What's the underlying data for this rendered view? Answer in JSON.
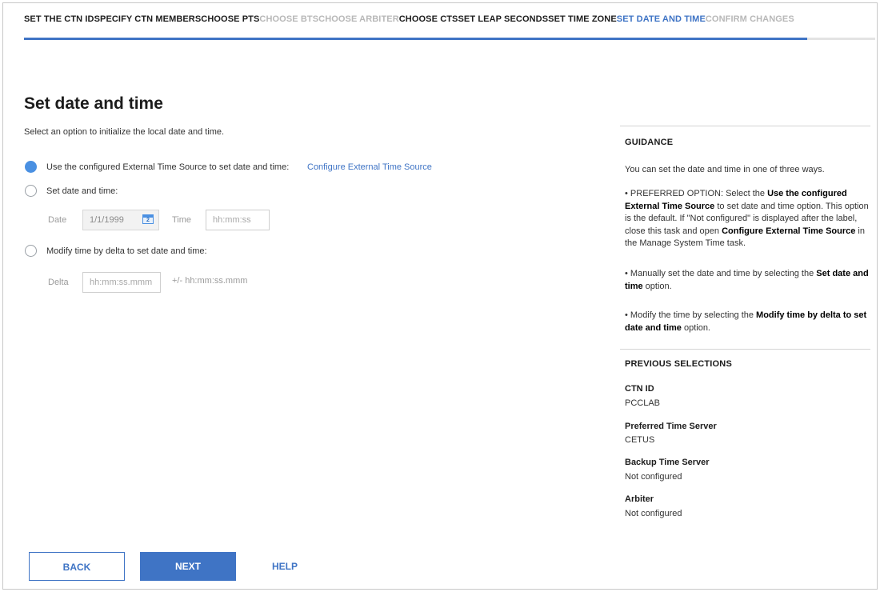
{
  "steps": [
    {
      "label": "SET THE CTN ID",
      "state": "done"
    },
    {
      "label": "SPECIFY CTN MEMBERS",
      "state": "done"
    },
    {
      "label": "CHOOSE PTS",
      "state": "done"
    },
    {
      "label": "CHOOSE BTS",
      "state": "disabled"
    },
    {
      "label": "CHOOSE ARBITER",
      "state": "disabled"
    },
    {
      "label": "CHOOSE CTS",
      "state": "done"
    },
    {
      "label": "SET LEAP SECONDS",
      "state": "done"
    },
    {
      "label": "SET TIME ZONE",
      "state": "done"
    },
    {
      "label": "SET DATE AND TIME",
      "state": "current"
    },
    {
      "label": "CONFIRM CHANGES",
      "state": "disabled"
    }
  ],
  "progress_fraction": 0.92,
  "colors": {
    "accent": "#3f74c5",
    "radio_selected": "#4a90e2",
    "disabled_step": "#b8b8b8"
  },
  "main": {
    "title": "Set date and time",
    "intro": "Select an option to initialize the local date and time.",
    "options": {
      "external": {
        "label": "Use the configured External Time Source to set date and time:",
        "link": "Configure External Time Source",
        "selected": true
      },
      "set": {
        "label": "Set date and time:",
        "selected": false
      },
      "delta": {
        "label": "Modify time by delta to set date and time:",
        "selected": false
      }
    },
    "date_label": "Date",
    "date_value": "1/1/1999",
    "calendar_icon": "calendar-icon",
    "calendar_glyph": "2",
    "time_label": "Time",
    "time_placeholder": "hh:mm:ss",
    "delta_label": "Delta",
    "delta_placeholder": "hh:mm:ss.mmm",
    "delta_hint": "+/- hh:mm:ss.mmm"
  },
  "buttons": {
    "back": "BACK",
    "next": "NEXT",
    "help": "HELP"
  },
  "guidance": {
    "heading": "GUIDANCE",
    "intro": "You can set the date and time in one of three ways.",
    "p1": {
      "a": "• PREFERRED OPTION: Select the ",
      "b": "Use the configured External Time Source",
      "c": " to set date and time option. This option is the default. If \"Not configured\" is displayed after the label, close this task and open ",
      "d": "Configure External Time Source",
      "e": " in the Manage System Time task."
    },
    "p2": {
      "a": "• Manually set the date and time by selecting the ",
      "b": "Set date and time",
      "c": " option."
    },
    "p3": {
      "a": "• Modify the time by selecting the ",
      "b": "Modify time by delta to set date and time",
      "c": " option."
    }
  },
  "previous": {
    "heading": "PREVIOUS SELECTIONS",
    "items": [
      {
        "label": "CTN ID",
        "value": "PCCLAB"
      },
      {
        "label": "Preferred Time Server",
        "value": "CETUS"
      },
      {
        "label": "Backup Time Server",
        "value": "Not configured"
      },
      {
        "label": "Arbiter",
        "value": "Not configured"
      }
    ]
  }
}
